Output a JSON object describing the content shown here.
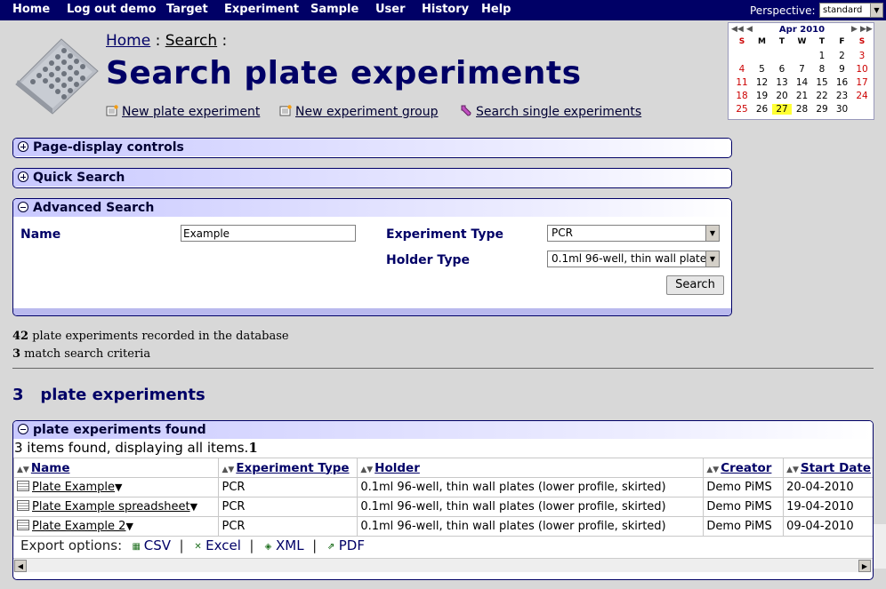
{
  "nav": {
    "items": [
      "Home",
      "Log out demo",
      "Target",
      "Experiment",
      "Sample",
      "User",
      "History",
      "Help"
    ],
    "perspective_label": "Perspective:",
    "perspective_value": "standard"
  },
  "breadcrumb": {
    "home": "Home",
    "search": "Search",
    "sep1": " : ",
    "sep2": " :"
  },
  "page_title": "Search plate experiments",
  "actions": {
    "new_plate": "New plate experiment",
    "new_group": "New experiment group",
    "search_single": "Search single experiments"
  },
  "calendar": {
    "month": "Apr 2010",
    "days_of_week": [
      "S",
      "M",
      "T",
      "W",
      "T",
      "F",
      "S"
    ],
    "weeks": [
      [
        "",
        "",
        "",
        "",
        "1",
        "2",
        "3"
      ],
      [
        "4",
        "5",
        "6",
        "7",
        "8",
        "9",
        "10"
      ],
      [
        "11",
        "12",
        "13",
        "14",
        "15",
        "16",
        "17"
      ],
      [
        "18",
        "19",
        "20",
        "21",
        "22",
        "23",
        "24"
      ],
      [
        "25",
        "26",
        "27",
        "28",
        "29",
        "30",
        ""
      ]
    ],
    "today": "27"
  },
  "panels": {
    "page_display": "Page-display controls",
    "quick_search": "Quick Search",
    "advanced_search": "Advanced Search",
    "results": "plate experiments found"
  },
  "advanced": {
    "name_label": "Name",
    "name_value": "Example",
    "exp_type_label": "Experiment Type",
    "exp_type_value": "PCR",
    "holder_type_label": "Holder Type",
    "holder_type_value": "0.1ml 96-well, thin wall plates (",
    "search_button": "Search"
  },
  "stats": {
    "recorded_count": "42",
    "recorded_text": " plate experiments recorded in the database",
    "match_count": "3",
    "match_text": " match search criteria"
  },
  "section": {
    "count": "3",
    "title": "plate experiments"
  },
  "results": {
    "items_found": "3 items found, displaying all items.",
    "page": "1",
    "columns": [
      "Name",
      "Experiment Type",
      "Holder",
      "Creator",
      "Start Date"
    ],
    "rows": [
      {
        "name": "Plate Example",
        "type": "PCR",
        "holder": "0.1ml 96-well, thin wall plates (lower profile, skirted)",
        "creator": "Demo PiMS",
        "date": "20-04-2010"
      },
      {
        "name": "Plate Example spreadsheet",
        "type": "PCR",
        "holder": "0.1ml 96-well, thin wall plates (lower profile, skirted)",
        "creator": "Demo PiMS",
        "date": "19-04-2010"
      },
      {
        "name": "Plate Example 2",
        "type": "PCR",
        "holder": "0.1ml 96-well, thin wall plates (lower profile, skirted)",
        "creator": "Demo PiMS",
        "date": "09-04-2010"
      }
    ],
    "export_label": "Export options:",
    "export": [
      "CSV",
      "Excel",
      "XML",
      "PDF"
    ]
  },
  "colors": {
    "nav_bg": "#000066",
    "title": "#000066",
    "panel_head": "#c9c9ff",
    "today": "#ffff33"
  }
}
